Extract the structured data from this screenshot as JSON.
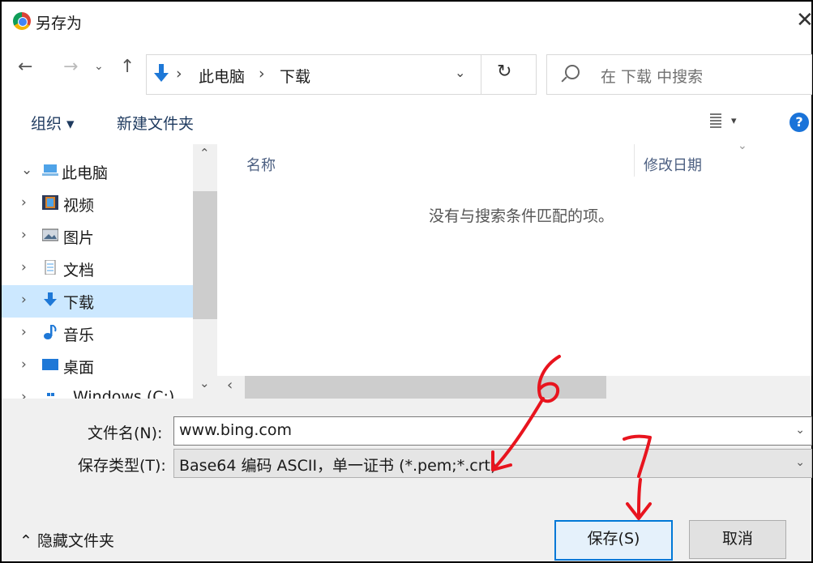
{
  "window": {
    "title": "另存为",
    "close_glyph": "✕"
  },
  "nav": {
    "back": "←",
    "forward": "→",
    "recent": "⌄",
    "up": "↑",
    "breadcrumb": [
      "此电脑",
      "下载"
    ],
    "breadcrumb_sep": "›",
    "refresh": "↻",
    "search_placeholder": "在 下载 中搜索"
  },
  "toolbar": {
    "organize": "组织 ▾",
    "new_folder": "新建文件夹",
    "help": "?"
  },
  "tree": {
    "items": [
      {
        "label": "此电脑",
        "chevron": "⌄",
        "icon": "computer-icon"
      },
      {
        "label": "视频",
        "chevron": "›",
        "icon": "video-icon"
      },
      {
        "label": "图片",
        "chevron": "›",
        "icon": "pictures-icon"
      },
      {
        "label": "文档",
        "chevron": "›",
        "icon": "documents-icon"
      },
      {
        "label": "下载",
        "chevron": "›",
        "icon": "download-icon",
        "selected": true
      },
      {
        "label": "音乐",
        "chevron": "›",
        "icon": "music-icon"
      },
      {
        "label": "桌面",
        "chevron": "›",
        "icon": "desktop-icon"
      },
      {
        "label": "Windows (C:)",
        "chevron": "›",
        "icon": "drive-icon"
      }
    ]
  },
  "files": {
    "columns": [
      "名称",
      "修改日期"
    ],
    "empty_message": "没有与搜索条件匹配的项。"
  },
  "form": {
    "filename_label": "文件名(N):",
    "filename_value": "www.bing.com",
    "type_label": "保存类型(T):",
    "type_value": "Base64 编码 ASCII，单一证书 (*.pem;*.crt)"
  },
  "footer": {
    "hide_folders": "⌃ 隐藏文件夹",
    "save": "保存(S)",
    "cancel": "取消"
  },
  "annotations": {
    "step_a": "6",
    "step_b": "7",
    "color": "#e8141e"
  }
}
